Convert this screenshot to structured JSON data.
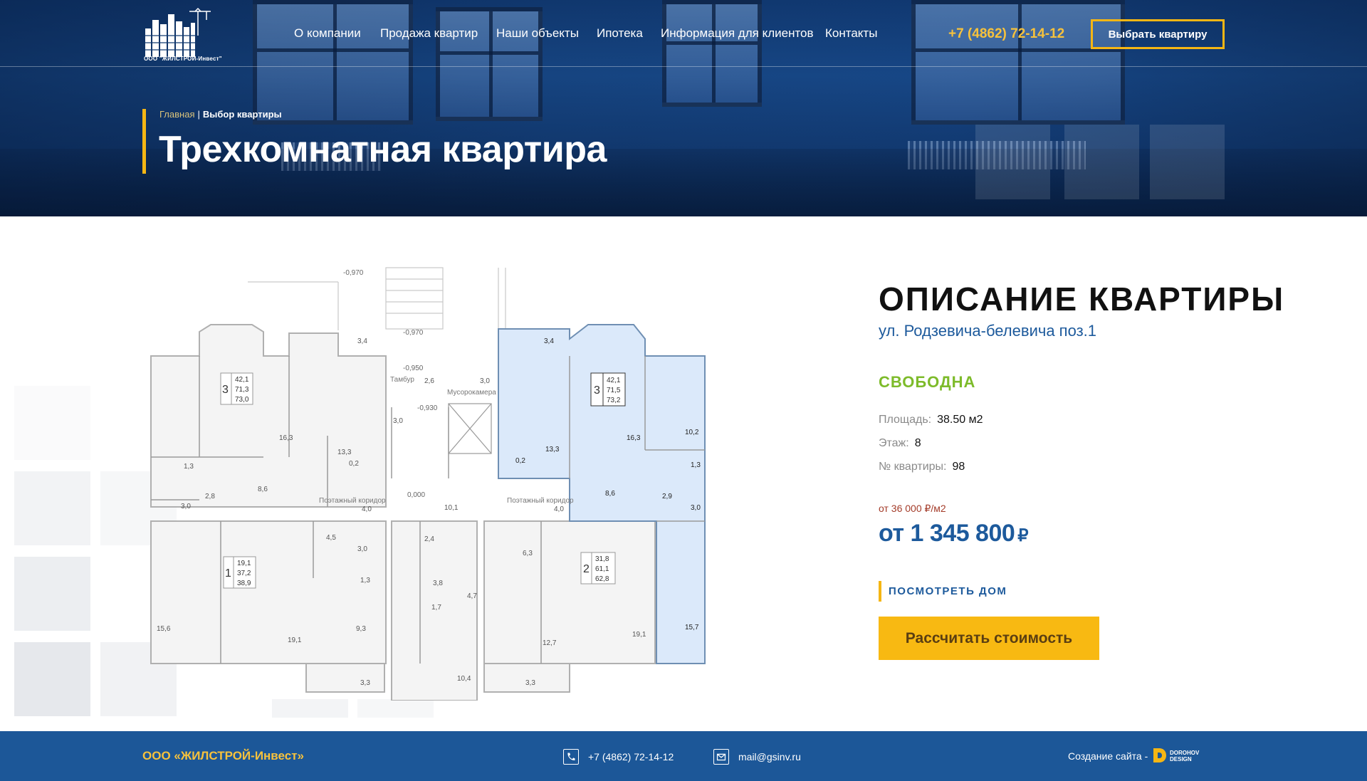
{
  "header": {
    "logo_caption": "ООО \"ЖИЛСТРОЙ-Инвест\"",
    "nav": [
      {
        "label": "О компании"
      },
      {
        "label": "Продажа квартир"
      },
      {
        "label": "Наши объекты"
      },
      {
        "label": "Ипотека"
      },
      {
        "label": "Информация для клиентов"
      },
      {
        "label": "Контакты"
      }
    ],
    "phone": "+7 (4862) 72-14-12",
    "cta_label": "Выбрать квартиру"
  },
  "hero": {
    "breadcrumb": {
      "home": "Главная",
      "separator": "|",
      "current": "Выбор квартиры"
    },
    "title": "Трехкомнатная квартира"
  },
  "plan": {
    "apartments": [
      {
        "rooms": "3",
        "areas": [
          "42,1",
          "71,3",
          "73,0"
        ]
      },
      {
        "rooms": "3",
        "areas": [
          "42,1",
          "71,5",
          "73,2"
        ]
      },
      {
        "rooms": "1",
        "areas": [
          "19,1",
          "37,2",
          "38,9"
        ]
      },
      {
        "rooms": "2",
        "areas": [
          "31,8",
          "61,1",
          "62,8"
        ]
      }
    ],
    "room_labels": [
      "3,4",
      "3,4",
      "16,3",
      "13,3",
      "0,2",
      "16,3",
      "10,2",
      "13,3",
      "0,2",
      "8,6",
      "8,6",
      "3,0",
      "2,8",
      "1,3",
      "1,3",
      "2,9",
      "3,0",
      "15,7",
      "15,6",
      "19,1",
      "9,3",
      "1,3",
      "3,0",
      "4,5",
      "4,0",
      "4,0",
      "10,1",
      "2,4",
      "3,8",
      "1,7",
      "4,7",
      "6,3",
      "12,7",
      "19,1",
      "10,4",
      "3,3",
      "3,3",
      "3,0",
      "2,6",
      "3,0"
    ],
    "level_labels": [
      "-0,970",
      "-0,970",
      "-0,950",
      "-0,930",
      "0,000"
    ],
    "text_labels": [
      "Тамбур",
      "Мусорокамера",
      "Поэтажный коридор",
      "Поэтажный коридор"
    ]
  },
  "details": {
    "section_title": "ОПИСАНИЕ КВАРТИРЫ",
    "address": "ул. Родзевича-белевича поз.1",
    "status": "СВОБОДНА",
    "status_color": "#7dbb2a",
    "properties": [
      {
        "key": "Площадь:",
        "value": "38.50 м2"
      },
      {
        "key": "Этаж:",
        "value": "8"
      },
      {
        "key": "№ квартиры:",
        "value": "98"
      }
    ],
    "price_per_m2": "от 36 000 ₽/м2",
    "price": "от 1 345 800",
    "currency": "₽",
    "house_link": "ПОСМОТРЕТЬ ДОМ",
    "calc_button": "Рассчитать стоимость"
  },
  "footer": {
    "company": "ООО «ЖИЛСТРОЙ-Инвест»",
    "phone": "+7 (4862) 72-14-12",
    "email": "mail@gsinv.ru",
    "credit": "Создание сайта -",
    "brand_top": "DOROHOV",
    "brand_bottom": "DESIGN"
  },
  "colors": {
    "accent_yellow": "#f5b614",
    "brand_blue": "#1d5a9c",
    "footer_blue": "#1c5798",
    "highlight_apartment": "#dbe9fa"
  }
}
